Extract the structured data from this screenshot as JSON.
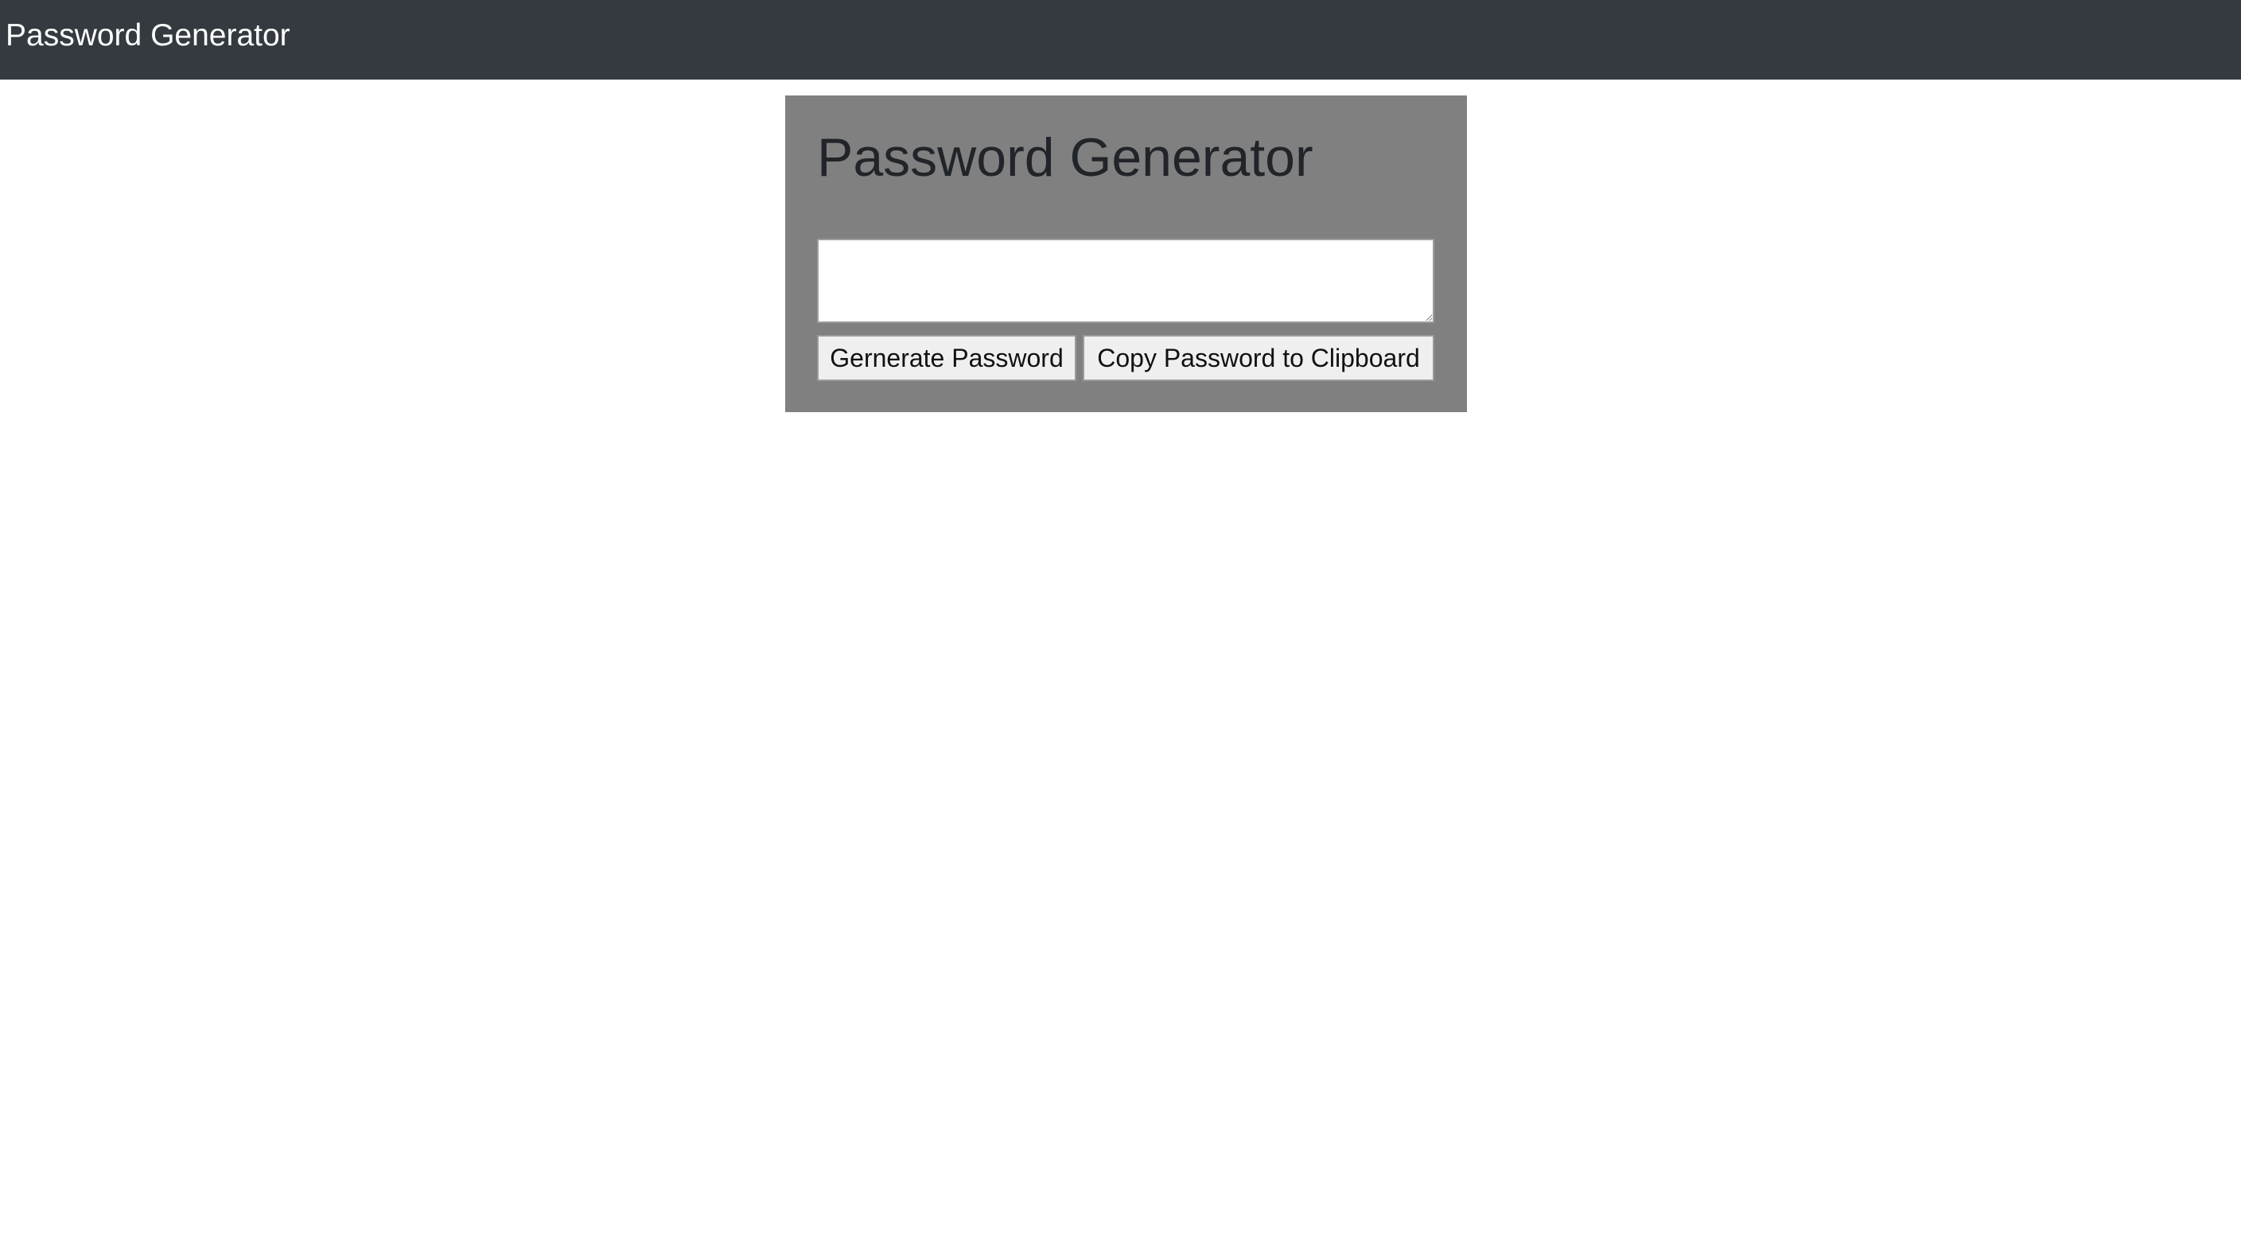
{
  "navbar": {
    "brand": "Password Generator"
  },
  "card": {
    "title": "Password Generator",
    "password_output": {
      "value": "",
      "placeholder": ""
    },
    "buttons": {
      "generate_label": "Gernerate Password",
      "copy_label": "Copy Password to Clipboard"
    }
  },
  "colors": {
    "navbar_background": "#343a40",
    "card_background": "#808080",
    "title_text": "#212529",
    "button_background": "#efefef"
  }
}
